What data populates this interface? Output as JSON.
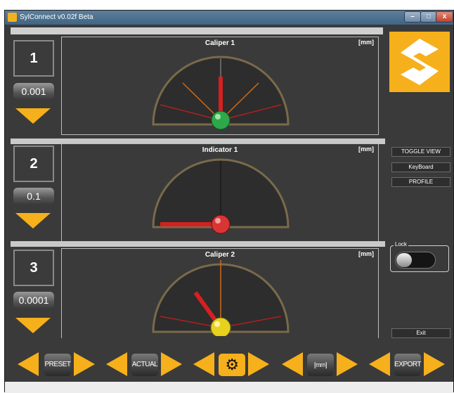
{
  "window": {
    "title": "SylConnect v0.02f Beta",
    "buttons": {
      "minimize": "–",
      "maximize": "□",
      "close": "x"
    }
  },
  "channels": [
    {
      "number": "1",
      "resolution": "0.001",
      "gauge": {
        "title": "Caliper 1",
        "unit": "[mm]",
        "knob_color": "#2ea84a"
      }
    },
    {
      "number": "2",
      "resolution": "0.1",
      "gauge": {
        "title": "Indicator 1",
        "unit": "[mm]",
        "knob_color": "#d93535"
      }
    },
    {
      "number": "3",
      "resolution": "0.0001",
      "gauge": {
        "title": "Caliper 2",
        "unit": "[mm]",
        "knob_color": "#e8d21e"
      }
    }
  ],
  "side": {
    "logo": "sylvac-logo",
    "toggle_view_label": "TOGGLE VIEW",
    "keyboard_label": "KeyBoard",
    "profile_label": "PROFILE",
    "lock_label": "Lock",
    "lock_state": "off",
    "exit_label": "Exit"
  },
  "bottom": {
    "preset_label": "PRESET",
    "actual_label": "ACTUAL",
    "settings_icon": "gear-icon",
    "unit_label": "[mm]",
    "export_label": "EXPORT"
  },
  "colors": {
    "accent": "#f6b01b",
    "background": "#3a3a3a"
  }
}
